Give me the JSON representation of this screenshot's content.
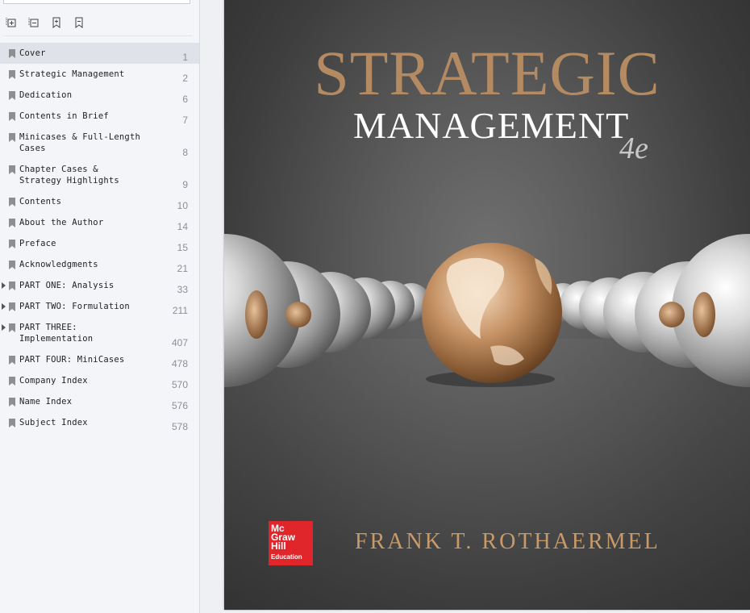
{
  "toolbar": {
    "icons": [
      "expand-all-icon",
      "collapse-all-icon",
      "add-bookmark-icon",
      "bookmark-icon"
    ]
  },
  "outline": [
    {
      "label": "Cover",
      "page": "1",
      "expandable": false,
      "selected": true
    },
    {
      "label": "Strategic Management",
      "page": "2",
      "expandable": false
    },
    {
      "label": "Dedication",
      "page": "6",
      "expandable": false
    },
    {
      "label": "Contents in Brief",
      "page": "7",
      "expandable": false
    },
    {
      "label": "Minicases & Full-Length Cases",
      "page": "8",
      "expandable": false
    },
    {
      "label": "Chapter Cases & Strategy Highlights",
      "page": "9",
      "expandable": false
    },
    {
      "label": "Contents",
      "page": "10",
      "expandable": false
    },
    {
      "label": "About the Author",
      "page": "14",
      "expandable": false
    },
    {
      "label": "Preface",
      "page": "15",
      "expandable": false
    },
    {
      "label": "Acknowledgments",
      "page": "21",
      "expandable": false
    },
    {
      "label": "PART ONE: Analysis",
      "page": "33",
      "expandable": true
    },
    {
      "label": "PART TWO: Formulation",
      "page": "211",
      "expandable": true
    },
    {
      "label": "PART THREE: Implementation",
      "page": "407",
      "expandable": true
    },
    {
      "label": "PART FOUR: MiniCases",
      "page": "478",
      "expandable": false
    },
    {
      "label": "Company Index",
      "page": "570",
      "expandable": false
    },
    {
      "label": "Name Index",
      "page": "576",
      "expandable": false
    },
    {
      "label": "Subject Index",
      "page": "578",
      "expandable": false
    }
  ],
  "cover": {
    "title_line1": "STRATEGIC",
    "title_line2": "MANAGEMENT",
    "edition": "4e",
    "author": "FRANK T. ROTHAERMEL",
    "publisher_logo": [
      "Mc",
      "Graw",
      "Hill",
      "Education"
    ],
    "colors": {
      "title": "#b38a62",
      "author": "#c89a68",
      "logo": "#e0262b"
    }
  }
}
